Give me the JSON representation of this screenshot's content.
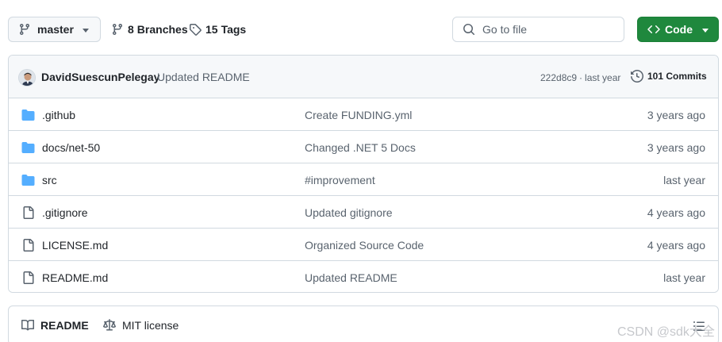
{
  "toolbar": {
    "branch": "master",
    "branches_count": "8",
    "branches_label": "Branches",
    "tags_count": "15",
    "tags_label": "Tags",
    "goto_placeholder": "Go to file",
    "code_label": "Code"
  },
  "latest_commit": {
    "author": "DavidSuescunPelegay",
    "message": "Updated README",
    "sha": "222d8c9",
    "separator": "·",
    "time": "last year",
    "commits_count": "101",
    "commits_label": "Commits"
  },
  "files": [
    {
      "name": ".github",
      "type": "folder",
      "message": "Create FUNDING.yml",
      "date": "3 years ago"
    },
    {
      "name": "docs/net-50",
      "type": "folder",
      "message": "Changed .NET 5 Docs",
      "date": "3 years ago"
    },
    {
      "name": "src",
      "type": "folder",
      "message": "#improvement",
      "date": "last year"
    },
    {
      "name": ".gitignore",
      "type": "file",
      "message": "Updated gitignore",
      "date": "4 years ago"
    },
    {
      "name": "LICENSE.md",
      "type": "file",
      "message": "Organized Source Code",
      "date": "4 years ago"
    },
    {
      "name": "README.md",
      "type": "file",
      "message": "Updated README",
      "date": "last year"
    }
  ],
  "readme_tabs": {
    "readme": "README",
    "license": "MIT license"
  },
  "watermark": "CSDN @sdk大全",
  "colors": {
    "folder_icon": "#54aeff",
    "code_button": "#1f883d",
    "muted_text": "#59636e",
    "border": "#d1d9e0"
  },
  "icons": {
    "branch": "git-branch-icon",
    "tag": "tag-icon",
    "search": "search-icon",
    "code": "code-icon",
    "history": "history-icon",
    "folder": "folder-icon",
    "file": "file-icon",
    "book": "book-icon",
    "law": "law-icon",
    "list": "list-unordered-icon"
  }
}
